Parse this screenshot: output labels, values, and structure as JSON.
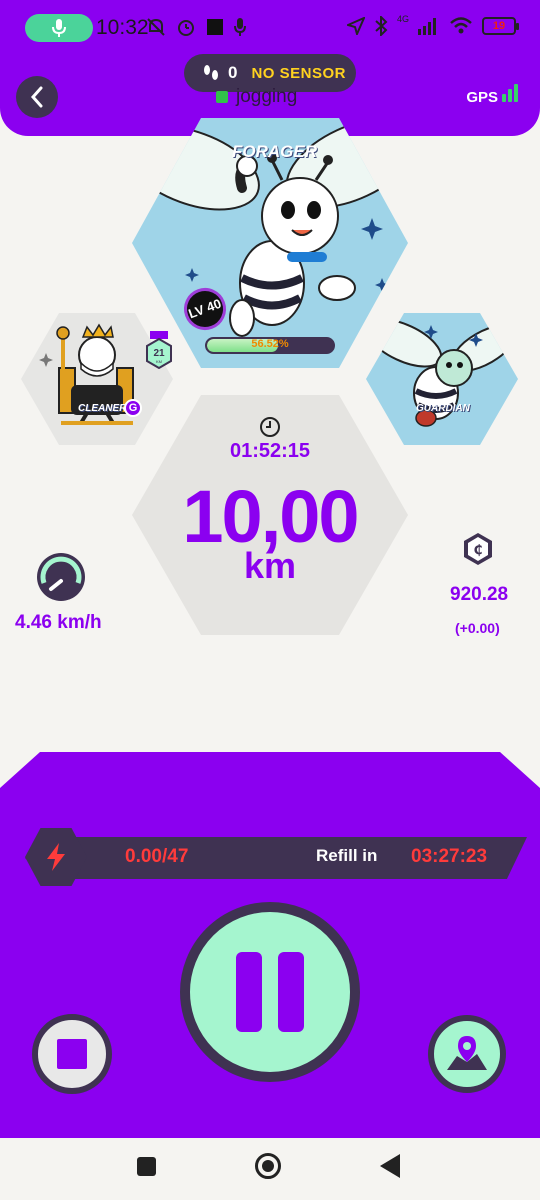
{
  "status_bar": {
    "time": "10:32",
    "battery": "19",
    "network": "4G"
  },
  "header": {
    "sensor_count": "0",
    "sensor_label": "NO SENSOR",
    "activity": "jogging",
    "gps_label": "GPS"
  },
  "bees": {
    "main": {
      "name": "FORAGER",
      "level": "LV 40",
      "xp_percent_label": "56.52%",
      "xp_fraction": 0.5652
    },
    "left": {
      "name": "CLEANER",
      "badge_value": "21",
      "badge_unit": "KM",
      "grade": "G"
    },
    "right": {
      "name": "GUARDIAN"
    }
  },
  "stats": {
    "timer": "01:52:15",
    "distance": "10,00",
    "unit": "km",
    "speed": "4.46 km/h",
    "balance": "920.28",
    "balance_delta": "(+0.00)"
  },
  "energy": {
    "value": "0.00/47",
    "refill_label": "Refill in",
    "refill_time": "03:27:23"
  },
  "colors": {
    "primary": "#8b00f0",
    "dark": "#3f3252",
    "mint": "#a5f5cf",
    "sky": "#9fd4e8",
    "alert": "#ff3b3b"
  }
}
